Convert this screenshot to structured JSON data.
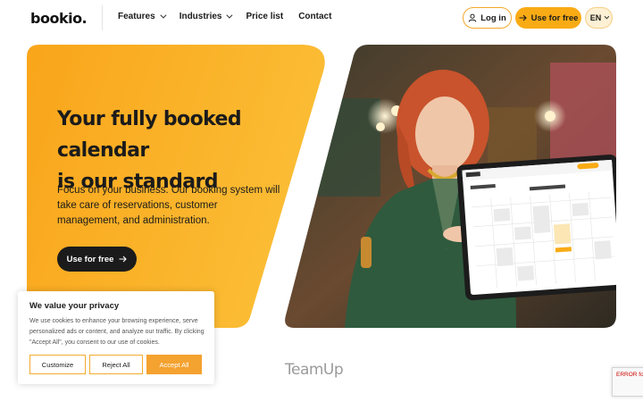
{
  "header": {
    "logo": "bookio.",
    "nav": [
      {
        "label": "Features",
        "has_dropdown": true
      },
      {
        "label": "Industries",
        "has_dropdown": true
      },
      {
        "label": "Price list",
        "has_dropdown": false
      },
      {
        "label": "Contact",
        "has_dropdown": false
      }
    ],
    "login_label": "Log in",
    "cta_label": "Use for free",
    "language": "EN"
  },
  "hero": {
    "title_line1": "Your fully booked calendar",
    "title_line2": "is our standard",
    "subtitle": "Focus on your business. Our booking system will take care of reservations, customer management, and administration.",
    "cta_label": "Use for free"
  },
  "cookie_banner": {
    "title": "We value your privacy",
    "text": "We use cookies to enhance your browsing experience, serve personalized ads or content, and analyze our traffic. By clicking \"Accept All\", you consent to our use of cookies.",
    "customize_label": "Customize",
    "reject_label": "Reject All",
    "accept_label": "Accept All"
  },
  "partner_logo": "TeamUp",
  "recaptcha_error": "ERROR for site key",
  "colors": {
    "accent": "#f9ab15",
    "dark": "#1b1b1b"
  }
}
